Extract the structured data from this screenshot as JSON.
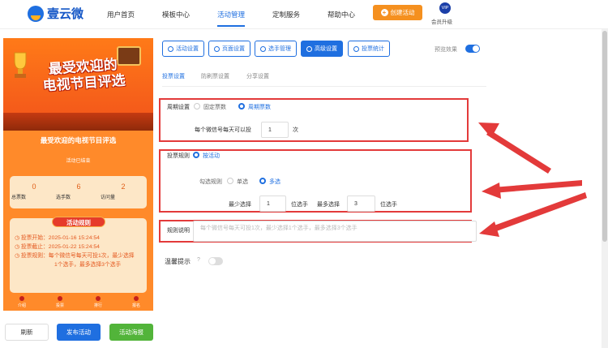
{
  "brand": {
    "name": "壹云微"
  },
  "nav": {
    "items": [
      {
        "label": "用户首页"
      },
      {
        "label": "模板中心"
      },
      {
        "label": "活动管理"
      },
      {
        "label": "定制服务"
      },
      {
        "label": "帮助中心"
      }
    ],
    "active_index": 2,
    "create_button": "创建活动",
    "vip_badge": "VIP",
    "vip_label": "会员升级"
  },
  "preview": {
    "banner_title_line1": "最受欢迎的",
    "banner_title_line2": "电视节目评选",
    "title": "最受欢迎的电视节目评选",
    "status": "活动已结束",
    "stats": [
      {
        "value": "0",
        "label": "总票数"
      },
      {
        "value": "6",
        "label": "选手数"
      },
      {
        "value": "2",
        "label": "访问量"
      }
    ],
    "rules_header": "活动规则",
    "rules": [
      "投票开始：2025-01-16 15:24:54",
      "投票截止：2025-01-22 15:24:54",
      "投票规则：每个微信号每天可投1次，最少选择",
      "1个选手，最多选择3个选手"
    ],
    "bottom_nav": [
      "介绍",
      "投票",
      "排行",
      "报名"
    ]
  },
  "actions": {
    "refresh": "刷新",
    "publish": "发布活动",
    "poster": "活动海报"
  },
  "toolbar": {
    "buttons": [
      {
        "label": "活动设置",
        "icon": "gear-icon"
      },
      {
        "label": "页面设置",
        "icon": "gear-icon"
      },
      {
        "label": "选手管理",
        "icon": "users-icon"
      },
      {
        "label": "高级设置",
        "icon": "sliders-icon"
      },
      {
        "label": "投票统计",
        "icon": "bar-chart-icon"
      }
    ],
    "active_index": 3,
    "preview_label": "预览效果",
    "preview_on": true
  },
  "subtabs": {
    "items": [
      "投票设置",
      "防刷票设置",
      "分享设置"
    ],
    "active_index": 0
  },
  "form": {
    "cycle": {
      "label": "周期设置",
      "options": [
        "固定票数",
        "周期票数"
      ],
      "selected": 1,
      "text_before": "每个微信号每天可以投",
      "value": "1",
      "text_after": "次"
    },
    "rule": {
      "label": "投票规则",
      "mode": "按活动",
      "check_label": "勾选规则",
      "options": [
        "单选",
        "多选"
      ],
      "selected": 1,
      "min_label": "最少选择",
      "min_value": "1",
      "min_unit": "位选手",
      "max_label": "最多选择",
      "max_value": "3",
      "max_unit": "位选手"
    },
    "description": {
      "label": "规则说明",
      "placeholder": "每个微信号每天可投1次，最少选择1个选手，最多选择3个选手"
    },
    "tip": {
      "label": "温馨提示",
      "enabled": false
    }
  },
  "colors": {
    "primary": "#1f6fe0",
    "orange": "#f5901f",
    "green": "#52b43a",
    "highlight_red": "#e33a3a"
  }
}
